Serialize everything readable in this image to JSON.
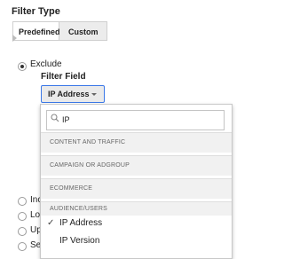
{
  "filter_type": {
    "label": "Filter Type",
    "tabs": [
      "Predefined",
      "Custom"
    ],
    "selected_tab": "Custom"
  },
  "exclude": {
    "label": "Exclude",
    "checked": true
  },
  "filter_field": {
    "label": "Filter Field",
    "dropdown_value": "IP Address"
  },
  "popup": {
    "search_value": "IP",
    "categories": [
      "CONTENT AND TRAFFIC",
      "CAMPAIGN OR ADGROUP",
      "ECOMMERCE",
      "AUDIENCE/USERS"
    ],
    "options": [
      {
        "label": "IP Address",
        "selected": true
      },
      {
        "label": "IP Version",
        "selected": false
      }
    ]
  },
  "partially_hidden_radios": [
    "Inc",
    "Lo",
    "Up",
    "Se"
  ],
  "colors": {
    "dropdown_border": "#3b78e7",
    "category_bg": "#f1f1f1",
    "tab_active_bg": "#ececec"
  }
}
